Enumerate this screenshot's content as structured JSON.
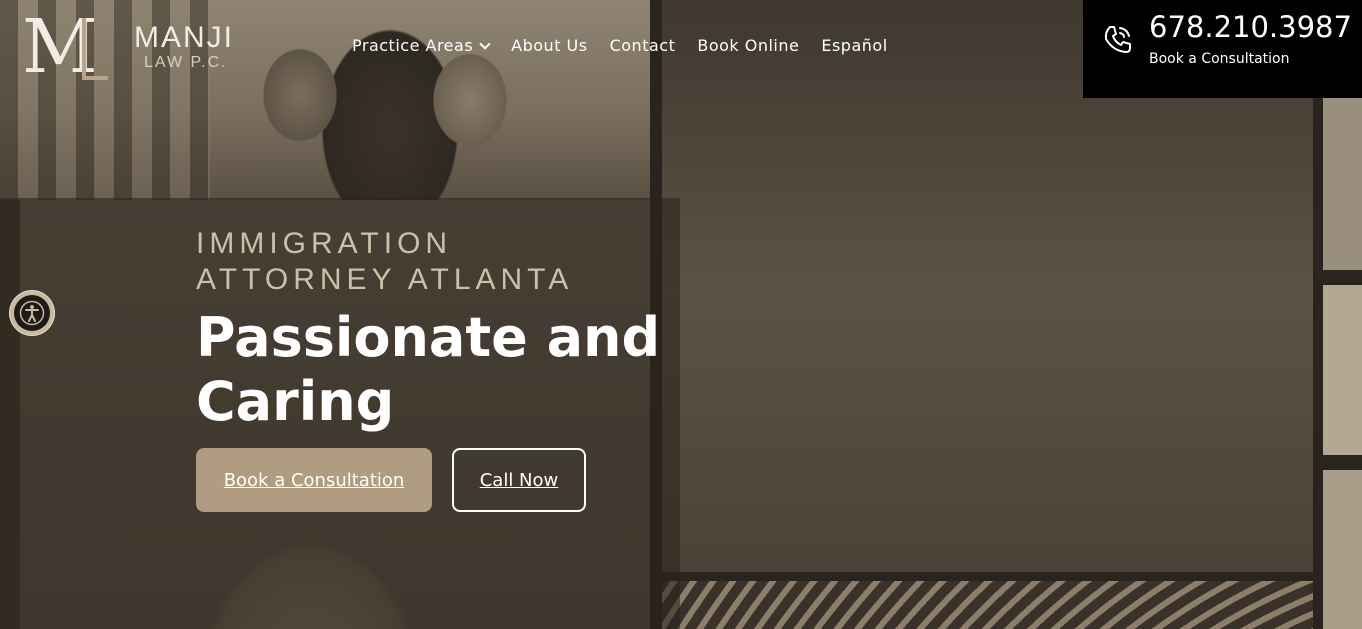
{
  "brand": {
    "name": "MANJI",
    "sub": "LAW P.C.",
    "monogram": "ML",
    "accent": "#b8a489"
  },
  "nav": {
    "items": [
      {
        "label": "Practice Areas",
        "has_dropdown": true
      },
      {
        "label": "About Us"
      },
      {
        "label": "Contact"
      },
      {
        "label": "Book Online"
      },
      {
        "label": "Español"
      }
    ]
  },
  "phone": {
    "number": "678.210.3987",
    "sub": "Book a Consultation",
    "icon": "phone-icon"
  },
  "accessibility": {
    "icon": "accessibility-icon"
  },
  "hero": {
    "eyebrow_line1": "IMMIGRATION",
    "eyebrow_line2": "ATTORNEY ATLANTA",
    "headline_line1": "Passionate and",
    "headline_line2": "Caring",
    "primary_button": "Book a Consultation",
    "secondary_button": "Call Now",
    "button_color": "#b09c80"
  }
}
